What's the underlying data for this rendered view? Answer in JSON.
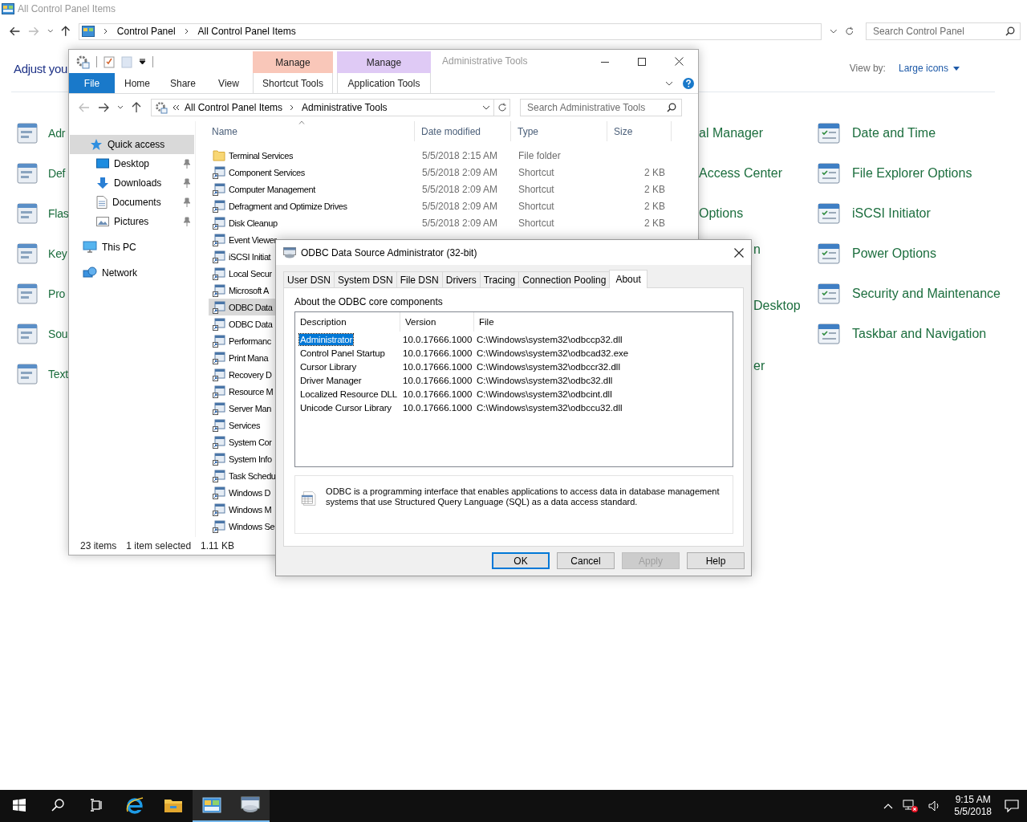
{
  "control_panel": {
    "title": "All Control Panel Items",
    "breadcrumb": [
      "Control Panel",
      "All Control Panel Items"
    ],
    "search": {
      "placeholder": "Search Control Panel"
    },
    "heading": "Adjust you",
    "view_by_label": "View by:",
    "view_by_value": "Large icons",
    "column_1": [
      "Adr",
      "Def",
      "Flas",
      "Key",
      "Pro",
      "Sou",
      "Text"
    ],
    "column_2": [
      "al Manager",
      "Access Center",
      "Options",
      "n",
      "Desktop",
      "er"
    ],
    "column_3": [
      "Date and Time",
      "File Explorer Options",
      "iSCSI Initiator",
      "Power Options",
      "Security and Maintenance",
      "Taskbar and Navigation"
    ]
  },
  "explorer": {
    "title": "Administrative Tools",
    "file_tab": "File",
    "ribbon_tabs": [
      "Home",
      "Share",
      "View"
    ],
    "context_tabs": [
      {
        "group": "Manage",
        "tab": "Shortcut Tools",
        "color": "#f9c7b9"
      },
      {
        "group": "Manage",
        "tab": "Application Tools",
        "color": "#dfcaf5"
      }
    ],
    "address": [
      "All Control Panel Items",
      "Administrative Tools"
    ],
    "search": {
      "placeholder": "Search Administrative Tools"
    },
    "nav": [
      {
        "label": "Quick access",
        "kind": "star",
        "selected": true,
        "pinned": false
      },
      {
        "label": "Desktop",
        "kind": "desktop",
        "selected": false,
        "pinned": true
      },
      {
        "label": "Downloads",
        "kind": "download",
        "selected": false,
        "pinned": true
      },
      {
        "label": "Documents",
        "kind": "document",
        "selected": false,
        "pinned": true
      },
      {
        "label": "Pictures",
        "kind": "picture",
        "selected": false,
        "pinned": true
      },
      {
        "label": "This PC",
        "kind": "pc",
        "selected": false,
        "pinned": false
      },
      {
        "label": "Network",
        "kind": "network",
        "selected": false,
        "pinned": false
      }
    ],
    "columns": [
      "Name",
      "Date modified",
      "Type",
      "Size"
    ],
    "files": [
      {
        "name": "Terminal Services",
        "kind": "folder",
        "date": "5/5/2018 2:15 AM",
        "type": "File folder",
        "selected": false
      },
      {
        "name": "Component Services",
        "kind": "shortcut",
        "date": "5/5/2018 2:09 AM",
        "type": "Shortcut",
        "size": "2 KB",
        "selected": false
      },
      {
        "name": "Computer Management",
        "kind": "shortcut",
        "date": "5/5/2018 2:09 AM",
        "type": "Shortcut",
        "size": "2 KB",
        "selected": false
      },
      {
        "name": "Defragment and Optimize Drives",
        "kind": "shortcut",
        "date": "5/5/2018 2:09 AM",
        "type": "Shortcut",
        "size": "2 KB",
        "selected": false
      },
      {
        "name": "Disk Cleanup",
        "kind": "shortcut",
        "date": "5/5/2018 2:09 AM",
        "type": "Shortcut",
        "size": "2 KB",
        "selected": false
      },
      {
        "name": "Event Viewer",
        "kind": "shortcut",
        "selected": false
      },
      {
        "name": "iSCSI Initiat",
        "kind": "shortcut",
        "selected": false
      },
      {
        "name": "Local Secur",
        "kind": "shortcut",
        "selected": false
      },
      {
        "name": "Microsoft A",
        "kind": "shortcut",
        "selected": false
      },
      {
        "name": "ODBC Data",
        "kind": "shortcut",
        "selected": true
      },
      {
        "name": "ODBC Data",
        "kind": "shortcut",
        "selected": false
      },
      {
        "name": "Performanc",
        "kind": "shortcut",
        "selected": false
      },
      {
        "name": "Print Mana",
        "kind": "shortcut",
        "selected": false
      },
      {
        "name": "Recovery D",
        "kind": "shortcut",
        "selected": false
      },
      {
        "name": "Resource M",
        "kind": "shortcut",
        "selected": false
      },
      {
        "name": "Server Man",
        "kind": "shortcut",
        "selected": false
      },
      {
        "name": "Services",
        "kind": "shortcut",
        "selected": false
      },
      {
        "name": "System Cor",
        "kind": "shortcut",
        "selected": false
      },
      {
        "name": "System Info",
        "kind": "shortcut",
        "selected": false
      },
      {
        "name": "Task Schedu",
        "kind": "shortcut",
        "selected": false
      },
      {
        "name": "Windows D",
        "kind": "shortcut",
        "selected": false
      },
      {
        "name": "Windows M",
        "kind": "shortcut",
        "selected": false
      },
      {
        "name": "Windows Se",
        "kind": "shortcut",
        "selected": false
      }
    ],
    "status": {
      "count": "23 items",
      "selection": "1 item selected",
      "size": "1.11 KB"
    }
  },
  "dialog": {
    "title": "ODBC Data Source Administrator (32-bit)",
    "tabs": [
      {
        "label": "User DSN",
        "selected": false
      },
      {
        "label": "System DSN",
        "selected": false
      },
      {
        "label": "File DSN",
        "selected": false
      },
      {
        "label": "Drivers",
        "selected": false
      },
      {
        "label": "Tracing",
        "selected": false
      },
      {
        "label": "Connection Pooling",
        "selected": false
      },
      {
        "label": "About",
        "selected": true
      }
    ],
    "section_label": "About the ODBC core components",
    "columns": [
      "Description",
      "Version",
      "File"
    ],
    "rows": [
      {
        "description": "Administrator",
        "version": "10.0.17666.1000",
        "file": "C:\\Windows\\system32\\odbccp32.dll",
        "selected": true
      },
      {
        "description": "Control Panel Startup",
        "version": "10.0.17666.1000",
        "file": "C:\\Windows\\system32\\odbcad32.exe",
        "selected": false
      },
      {
        "description": "Cursor Library",
        "version": "10.0.17666.1000",
        "file": "C:\\Windows\\system32\\odbccr32.dll",
        "selected": false
      },
      {
        "description": "Driver Manager",
        "version": "10.0.17666.1000",
        "file": "C:\\Windows\\system32\\odbc32.dll",
        "selected": false
      },
      {
        "description": "Localized Resource DLL",
        "version": "10.0.17666.1000",
        "file": "C:\\Windows\\system32\\odbcint.dll",
        "selected": false
      },
      {
        "description": "Unicode Cursor Library",
        "version": "10.0.17666.1000",
        "file": "C:\\Windows\\system32\\odbccu32.dll",
        "selected": false
      }
    ],
    "info": "ODBC is a programming interface that enables applications to access data in database management systems that use Structured Query Language (SQL) as a data access standard.",
    "buttons": [
      {
        "label": "OK",
        "kind": "default"
      },
      {
        "label": "Cancel",
        "kind": "normal"
      },
      {
        "label": "Apply",
        "kind": "disabled"
      },
      {
        "label": "Help",
        "kind": "normal"
      }
    ]
  },
  "taskbar": {
    "buttons": [
      {
        "kind": "start",
        "running": false
      },
      {
        "kind": "search",
        "running": false
      },
      {
        "kind": "taskview",
        "running": false
      },
      {
        "kind": "browser",
        "running": false
      },
      {
        "kind": "folder",
        "running": false
      },
      {
        "kind": "controlpanel",
        "running": true
      },
      {
        "kind": "odbc",
        "running": true
      }
    ],
    "time": "9:15 AM",
    "date": "5/5/2018"
  }
}
